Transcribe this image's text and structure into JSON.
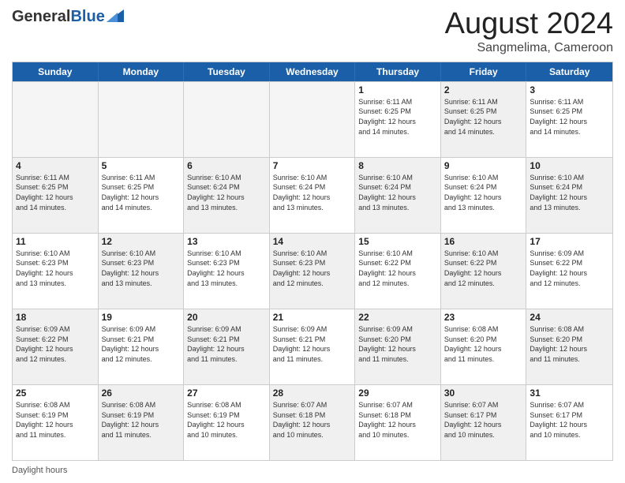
{
  "header": {
    "logo": {
      "general": "General",
      "blue": "Blue"
    },
    "title": "August 2024",
    "location": "Sangmelima, Cameroon"
  },
  "days": [
    "Sunday",
    "Monday",
    "Tuesday",
    "Wednesday",
    "Thursday",
    "Friday",
    "Saturday"
  ],
  "footer": {
    "daylight_label": "Daylight hours"
  },
  "weeks": [
    {
      "cells": [
        {
          "day": "",
          "content": "",
          "empty": true
        },
        {
          "day": "",
          "content": "",
          "empty": true
        },
        {
          "day": "",
          "content": "",
          "empty": true
        },
        {
          "day": "",
          "content": "",
          "empty": true
        },
        {
          "day": "1",
          "content": "Sunrise: 6:11 AM\nSunset: 6:25 PM\nDaylight: 12 hours\nand 14 minutes.",
          "shaded": false
        },
        {
          "day": "2",
          "content": "Sunrise: 6:11 AM\nSunset: 6:25 PM\nDaylight: 12 hours\nand 14 minutes.",
          "shaded": true
        },
        {
          "day": "3",
          "content": "Sunrise: 6:11 AM\nSunset: 6:25 PM\nDaylight: 12 hours\nand 14 minutes.",
          "shaded": false
        }
      ]
    },
    {
      "cells": [
        {
          "day": "4",
          "content": "Sunrise: 6:11 AM\nSunset: 6:25 PM\nDaylight: 12 hours\nand 14 minutes.",
          "shaded": true
        },
        {
          "day": "5",
          "content": "Sunrise: 6:11 AM\nSunset: 6:25 PM\nDaylight: 12 hours\nand 14 minutes.",
          "shaded": false
        },
        {
          "day": "6",
          "content": "Sunrise: 6:10 AM\nSunset: 6:24 PM\nDaylight: 12 hours\nand 13 minutes.",
          "shaded": true
        },
        {
          "day": "7",
          "content": "Sunrise: 6:10 AM\nSunset: 6:24 PM\nDaylight: 12 hours\nand 13 minutes.",
          "shaded": false
        },
        {
          "day": "8",
          "content": "Sunrise: 6:10 AM\nSunset: 6:24 PM\nDaylight: 12 hours\nand 13 minutes.",
          "shaded": true
        },
        {
          "day": "9",
          "content": "Sunrise: 6:10 AM\nSunset: 6:24 PM\nDaylight: 12 hours\nand 13 minutes.",
          "shaded": false
        },
        {
          "day": "10",
          "content": "Sunrise: 6:10 AM\nSunset: 6:24 PM\nDaylight: 12 hours\nand 13 minutes.",
          "shaded": true
        }
      ]
    },
    {
      "cells": [
        {
          "day": "11",
          "content": "Sunrise: 6:10 AM\nSunset: 6:23 PM\nDaylight: 12 hours\nand 13 minutes.",
          "shaded": false
        },
        {
          "day": "12",
          "content": "Sunrise: 6:10 AM\nSunset: 6:23 PM\nDaylight: 12 hours\nand 13 minutes.",
          "shaded": true
        },
        {
          "day": "13",
          "content": "Sunrise: 6:10 AM\nSunset: 6:23 PM\nDaylight: 12 hours\nand 13 minutes.",
          "shaded": false
        },
        {
          "day": "14",
          "content": "Sunrise: 6:10 AM\nSunset: 6:23 PM\nDaylight: 12 hours\nand 12 minutes.",
          "shaded": true
        },
        {
          "day": "15",
          "content": "Sunrise: 6:10 AM\nSunset: 6:22 PM\nDaylight: 12 hours\nand 12 minutes.",
          "shaded": false
        },
        {
          "day": "16",
          "content": "Sunrise: 6:10 AM\nSunset: 6:22 PM\nDaylight: 12 hours\nand 12 minutes.",
          "shaded": true
        },
        {
          "day": "17",
          "content": "Sunrise: 6:09 AM\nSunset: 6:22 PM\nDaylight: 12 hours\nand 12 minutes.",
          "shaded": false
        }
      ]
    },
    {
      "cells": [
        {
          "day": "18",
          "content": "Sunrise: 6:09 AM\nSunset: 6:22 PM\nDaylight: 12 hours\nand 12 minutes.",
          "shaded": true
        },
        {
          "day": "19",
          "content": "Sunrise: 6:09 AM\nSunset: 6:21 PM\nDaylight: 12 hours\nand 12 minutes.",
          "shaded": false
        },
        {
          "day": "20",
          "content": "Sunrise: 6:09 AM\nSunset: 6:21 PM\nDaylight: 12 hours\nand 11 minutes.",
          "shaded": true
        },
        {
          "day": "21",
          "content": "Sunrise: 6:09 AM\nSunset: 6:21 PM\nDaylight: 12 hours\nand 11 minutes.",
          "shaded": false
        },
        {
          "day": "22",
          "content": "Sunrise: 6:09 AM\nSunset: 6:20 PM\nDaylight: 12 hours\nand 11 minutes.",
          "shaded": true
        },
        {
          "day": "23",
          "content": "Sunrise: 6:08 AM\nSunset: 6:20 PM\nDaylight: 12 hours\nand 11 minutes.",
          "shaded": false
        },
        {
          "day": "24",
          "content": "Sunrise: 6:08 AM\nSunset: 6:20 PM\nDaylight: 12 hours\nand 11 minutes.",
          "shaded": true
        }
      ]
    },
    {
      "cells": [
        {
          "day": "25",
          "content": "Sunrise: 6:08 AM\nSunset: 6:19 PM\nDaylight: 12 hours\nand 11 minutes.",
          "shaded": false
        },
        {
          "day": "26",
          "content": "Sunrise: 6:08 AM\nSunset: 6:19 PM\nDaylight: 12 hours\nand 11 minutes.",
          "shaded": true
        },
        {
          "day": "27",
          "content": "Sunrise: 6:08 AM\nSunset: 6:19 PM\nDaylight: 12 hours\nand 10 minutes.",
          "shaded": false
        },
        {
          "day": "28",
          "content": "Sunrise: 6:07 AM\nSunset: 6:18 PM\nDaylight: 12 hours\nand 10 minutes.",
          "shaded": true
        },
        {
          "day": "29",
          "content": "Sunrise: 6:07 AM\nSunset: 6:18 PM\nDaylight: 12 hours\nand 10 minutes.",
          "shaded": false
        },
        {
          "day": "30",
          "content": "Sunrise: 6:07 AM\nSunset: 6:17 PM\nDaylight: 12 hours\nand 10 minutes.",
          "shaded": true
        },
        {
          "day": "31",
          "content": "Sunrise: 6:07 AM\nSunset: 6:17 PM\nDaylight: 12 hours\nand 10 minutes.",
          "shaded": false
        }
      ]
    }
  ]
}
